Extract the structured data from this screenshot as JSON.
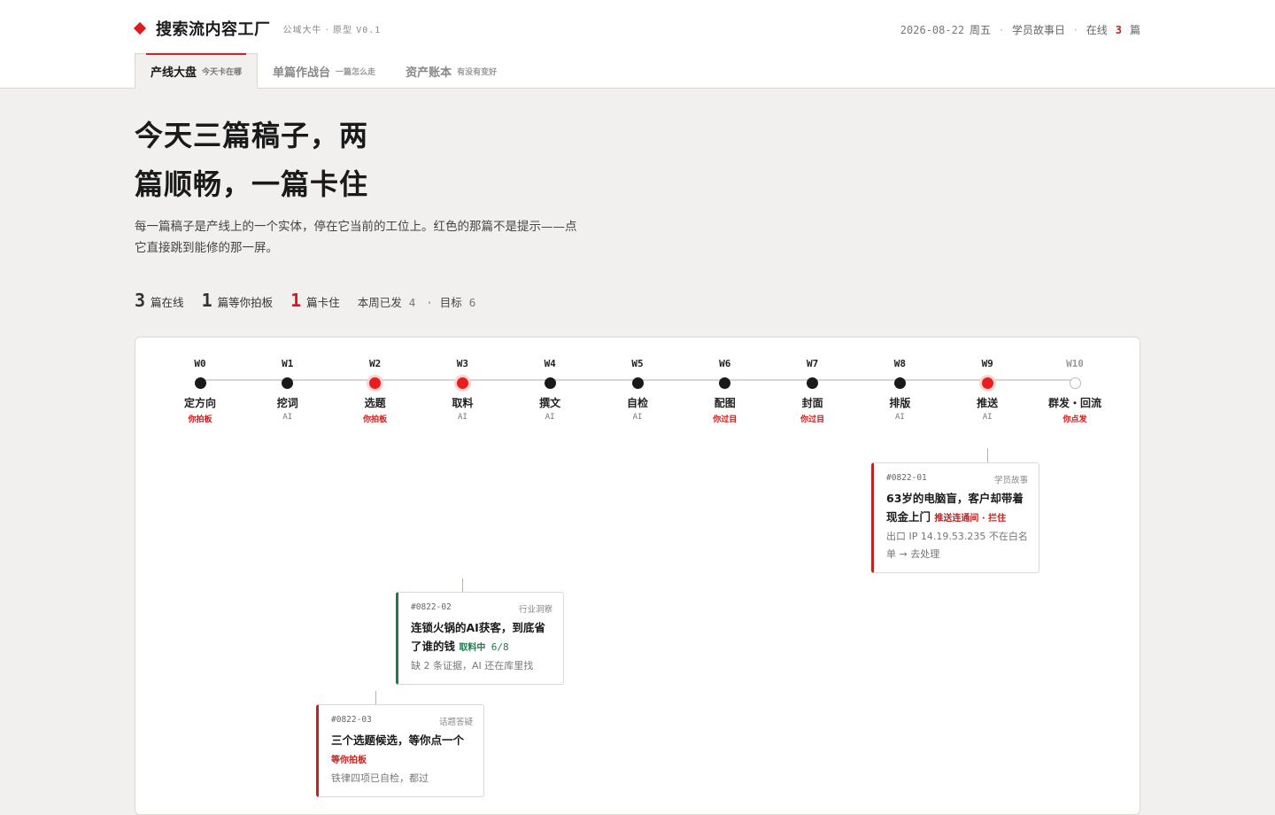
{
  "brand": {
    "name": "搜索流内容工厂",
    "sub_tag": "公域大牛 · 原型",
    "version": "V0.1"
  },
  "header": {
    "date": "2026-08-22",
    "weekday": "周五",
    "theme": "学员故事日",
    "online_prefix": "在线",
    "online_count": "3",
    "online_suffix": "篇"
  },
  "tabs": [
    {
      "label": "产线大盘",
      "sub": "今天卡在哪",
      "active": true
    },
    {
      "label": "单篇作战台",
      "sub": "一篇怎么走",
      "active": false
    },
    {
      "label": "资产账本",
      "sub": "有没有变好",
      "active": false
    }
  ],
  "hero": {
    "title": "今天三篇稿子，两篇顺畅，一篇卡住",
    "desc": "每一篇稿子是产线上的一个实体，停在它当前的工位上。红色的那篇不是提示——点它直接跳到能修的那一屏。"
  },
  "stats": {
    "online_num": "3",
    "online_label": "篇在线",
    "waiting_num": "1",
    "waiting_label": "篇等你拍板",
    "stuck_num": "1",
    "stuck_label": "篇卡住",
    "week_label": "本周已发",
    "week_value": "4",
    "sep": "·",
    "target_label": "目标",
    "target_value": "6"
  },
  "stations": [
    {
      "code": "W0",
      "name": "定方向",
      "owner": "你拍板",
      "owner_type": "you",
      "state": "done"
    },
    {
      "code": "W1",
      "name": "挖词",
      "owner": "AI",
      "owner_type": "ai",
      "state": "done"
    },
    {
      "code": "W2",
      "name": "选题",
      "owner": "你拍板",
      "owner_type": "you",
      "state": "active"
    },
    {
      "code": "W3",
      "name": "取料",
      "owner": "AI",
      "owner_type": "ai",
      "state": "active"
    },
    {
      "code": "W4",
      "name": "撰文",
      "owner": "AI",
      "owner_type": "ai",
      "state": "done"
    },
    {
      "code": "W5",
      "name": "自检",
      "owner": "AI",
      "owner_type": "ai",
      "state": "done"
    },
    {
      "code": "W6",
      "name": "配图",
      "owner": "你过目",
      "owner_type": "you",
      "state": "done"
    },
    {
      "code": "W7",
      "name": "封面",
      "owner": "你过目",
      "owner_type": "you",
      "state": "done"
    },
    {
      "code": "W8",
      "name": "排版",
      "owner": "AI",
      "owner_type": "ai",
      "state": "done"
    },
    {
      "code": "W9",
      "name": "推送",
      "owner": "AI",
      "owner_type": "ai",
      "state": "active"
    },
    {
      "code": "W10",
      "name": "群发・回流",
      "owner": "你点发",
      "owner_type": "you",
      "state": "pending"
    }
  ],
  "cards": [
    {
      "id": "#0822-01",
      "category": "学员故事",
      "title": "63岁的电脑盲，客户却带着现金上门",
      "status": "推送连通间 · 拦住",
      "status_color": "red",
      "progress": "",
      "note": "出口 IP 14.19.53.235 不在白名单 → 去处理",
      "station": "W9"
    },
    {
      "id": "#0822-02",
      "category": "行业洞察",
      "title": "连锁火锅的AI获客，到底省了谁的钱",
      "status": "取料中",
      "status_color": "green",
      "progress": "6/8",
      "note": "缺 2 条证据，AI 还在库里找",
      "station": "W3"
    },
    {
      "id": "#0822-03",
      "category": "话题答疑",
      "title": "三个选题候选，等你点一个",
      "status": "等你拍板",
      "status_color": "red",
      "progress": "",
      "note": "铁律四项已自检，都过",
      "station": "W2"
    }
  ],
  "colors": {
    "accent": "#e01b1b",
    "ok": "#1f7a4a",
    "ink": "#1a1a1a"
  }
}
